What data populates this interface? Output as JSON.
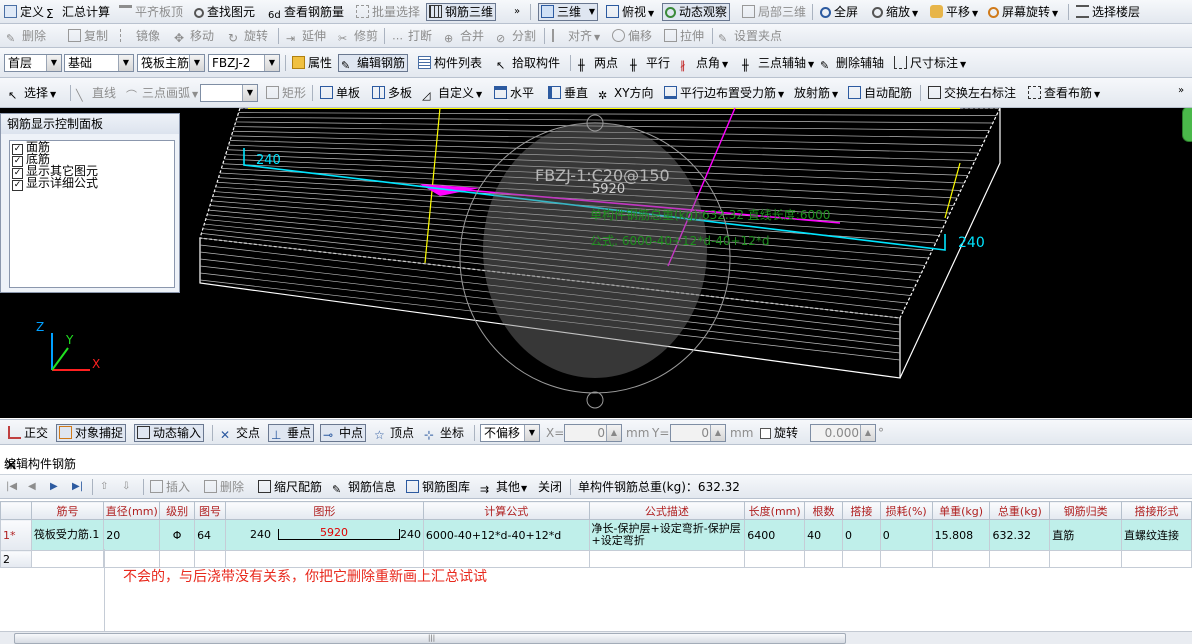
{
  "toolbar1": {
    "items": [
      {
        "label": "定义",
        "icon": "define-icon"
      },
      {
        "label": "汇总计算",
        "icon": "sigma-icon"
      },
      {
        "label": "平齐板顶",
        "icon": "align-top-icon",
        "disabled": true
      },
      {
        "label": "查找图元",
        "icon": "find-icon"
      },
      {
        "label": "查看钢筋量",
        "icon": "rebar-qty-icon"
      },
      {
        "label": "批量选择",
        "icon": "batch-select-icon",
        "disabled": true
      },
      {
        "label": "钢筋三维",
        "icon": "rebar-3d-icon"
      },
      {
        "label": "三维",
        "icon": "3d-icon"
      },
      {
        "label": "俯视",
        "icon": "top-view-icon"
      },
      {
        "label": "动态观察",
        "icon": "orbit-icon"
      },
      {
        "label": "局部三维",
        "icon": "local-3d-icon",
        "disabled": true
      },
      {
        "label": "全屏",
        "icon": "fullscreen-icon"
      },
      {
        "label": "缩放",
        "icon": "zoom-icon"
      },
      {
        "label": "平移",
        "icon": "pan-icon"
      },
      {
        "label": "屏幕旋转",
        "icon": "screen-rotate-icon"
      },
      {
        "label": "选择楼层",
        "icon": "select-floor-icon"
      }
    ],
    "more": "»"
  },
  "toolbar2": {
    "items": [
      {
        "label": "删除",
        "icon": "delete-icon"
      },
      {
        "label": "复制",
        "icon": "copy-icon"
      },
      {
        "label": "镜像",
        "icon": "mirror-icon"
      },
      {
        "label": "移动",
        "icon": "move-icon"
      },
      {
        "label": "旋转",
        "icon": "rotate-icon"
      },
      {
        "label": "延伸",
        "icon": "extend-icon"
      },
      {
        "label": "修剪",
        "icon": "trim-icon"
      },
      {
        "label": "打断",
        "icon": "break-icon"
      },
      {
        "label": "合并",
        "icon": "merge-icon"
      },
      {
        "label": "分割",
        "icon": "split-icon"
      },
      {
        "label": "对齐",
        "icon": "align-icon"
      },
      {
        "label": "偏移",
        "icon": "offset-icon"
      },
      {
        "label": "拉伸",
        "icon": "stretch-icon"
      },
      {
        "label": "设置夹点",
        "icon": "grip-icon"
      }
    ]
  },
  "toolbar3": {
    "floor": "首层",
    "layer": "基础",
    "category": "筏板主筋",
    "component": "FBZJ-2",
    "items": [
      {
        "label": "属性",
        "icon": "properties-icon"
      },
      {
        "label": "编辑钢筋",
        "icon": "edit-rebar-icon"
      },
      {
        "label": "构件列表",
        "icon": "component-list-icon"
      },
      {
        "label": "拾取构件",
        "icon": "pick-component-icon"
      },
      {
        "label": "两点",
        "icon": "two-point-icon"
      },
      {
        "label": "平行",
        "icon": "parallel-icon"
      },
      {
        "label": "点角",
        "icon": "point-angle-icon"
      },
      {
        "label": "三点辅轴",
        "icon": "three-point-axis-icon"
      },
      {
        "label": "删除辅轴",
        "icon": "delete-axis-icon"
      },
      {
        "label": "尺寸标注",
        "icon": "dimension-icon"
      }
    ]
  },
  "toolbar4": {
    "items": [
      {
        "label": "选择",
        "icon": "select-cursor-icon"
      },
      {
        "label": "直线",
        "icon": "line-icon"
      },
      {
        "label": "三点画弧",
        "icon": "arc-icon"
      },
      {
        "label": "矩形",
        "icon": "rectangle-icon"
      },
      {
        "label": "单板",
        "icon": "single-slab-icon"
      },
      {
        "label": "多板",
        "icon": "multi-slab-icon"
      },
      {
        "label": "自定义",
        "icon": "custom-icon"
      },
      {
        "label": "水平",
        "icon": "horizontal-icon"
      },
      {
        "label": "垂直",
        "icon": "vertical-icon"
      },
      {
        "label": "XY方向",
        "icon": "xy-direction-icon"
      },
      {
        "label": "平行边布置受力筋",
        "icon": "parallel-edge-icon"
      },
      {
        "label": "放射筋",
        "icon": "radial-icon"
      },
      {
        "label": "自动配筋",
        "icon": "auto-rebar-icon"
      },
      {
        "label": "交换左右标注",
        "icon": "swap-label-icon"
      },
      {
        "label": "查看布筋",
        "icon": "view-layout-icon"
      }
    ]
  },
  "panel": {
    "title": "钢筋显示控制面板",
    "options": [
      {
        "label": "面筋",
        "checked": true
      },
      {
        "label": "底筋",
        "checked": true
      },
      {
        "label": "显示其它图元",
        "checked": true
      },
      {
        "label": "显示详细公式",
        "checked": true
      }
    ]
  },
  "viewport": {
    "label_main": "FBZJ-1:C20@150",
    "label_len": "5920",
    "label_left": "240",
    "label_right": "240",
    "green_line1": "单构件钢筋总重(kg):632.32 直线长度:6000",
    "green_line2": "公式: 6000-40+12*d-40+12*d",
    "axis_z": "Z",
    "axis_y": "Y",
    "axis_x": "X"
  },
  "snapbar": {
    "items": [
      {
        "label": "正交",
        "icon": "ortho-icon"
      },
      {
        "label": "对象捕捉",
        "icon": "object-snap-icon"
      },
      {
        "label": "动态输入",
        "icon": "dynamic-input-icon"
      },
      {
        "label": "交点",
        "icon": "intersection-icon"
      },
      {
        "label": "垂点",
        "icon": "perpendicular-icon"
      },
      {
        "label": "中点",
        "icon": "midpoint-icon"
      },
      {
        "label": "顶点",
        "icon": "vertex-icon"
      },
      {
        "label": "坐标",
        "icon": "coordinate-icon"
      }
    ],
    "offset_mode": "不偏移",
    "x_label": "X=",
    "x_value": "0",
    "y_label": "Y=",
    "y_value": "0",
    "unit": "mm",
    "rotate_label": "旋转",
    "rotate_value": "0.000",
    "degree": "°"
  },
  "panel_title": "编辑构件钢筋",
  "close_label": "×",
  "edit_toolbar": {
    "items": [
      {
        "label": "插入",
        "disabled": true,
        "icon": "insert-icon"
      },
      {
        "label": "删除",
        "disabled": true,
        "icon": "delete-row-icon"
      },
      {
        "label": "缩尺配筋",
        "icon": "scale-rebar-icon"
      },
      {
        "label": "钢筋信息",
        "icon": "rebar-info-icon"
      },
      {
        "label": "钢筋图库",
        "icon": "rebar-library-icon"
      },
      {
        "label": "其他",
        "icon": "other-icon"
      },
      {
        "label": "关闭",
        "icon": ""
      }
    ],
    "total_label": "单构件钢筋总重(kg)：632.32"
  },
  "table": {
    "headers": [
      "",
      "筋号",
      "直径(mm)",
      "级别",
      "图号",
      "图形",
      "计算公式",
      "公式描述",
      "长度(mm)",
      "根数",
      "搭接",
      "损耗(%)",
      "单重(kg)",
      "总重(kg)",
      "钢筋归类",
      "搭接形式"
    ],
    "rows": [
      {
        "num": "1*",
        "name": "筏板受力筋.1",
        "diameter": "20",
        "grade": "Φ",
        "figure_no": "64",
        "shape_left": "240",
        "shape_mid": "5920",
        "shape_right": "240",
        "formula": "6000-40+12*d-40+12*d",
        "desc": "净长-保护层+设定弯折-保护层+设定弯折",
        "length": "6400",
        "count": "40",
        "lap": "0",
        "loss": "0",
        "unit_weight": "15.808",
        "total_weight": "632.32",
        "category": "直筋",
        "lap_type": "直螺纹连接"
      },
      {
        "num": "2"
      }
    ]
  },
  "comment": "不会的，与后浇带没有关系，你把它删除重新画上汇总试试",
  "colors": {
    "viewport_bg": "#000000",
    "slab_line": "#ffffff",
    "yellow": "#ffff00",
    "cyan": "#00e5ff",
    "magenta": "#ff00ff",
    "green_text": "#1d8f1d",
    "comment_red": "#e8291d",
    "row_selected": "#bfefea"
  }
}
